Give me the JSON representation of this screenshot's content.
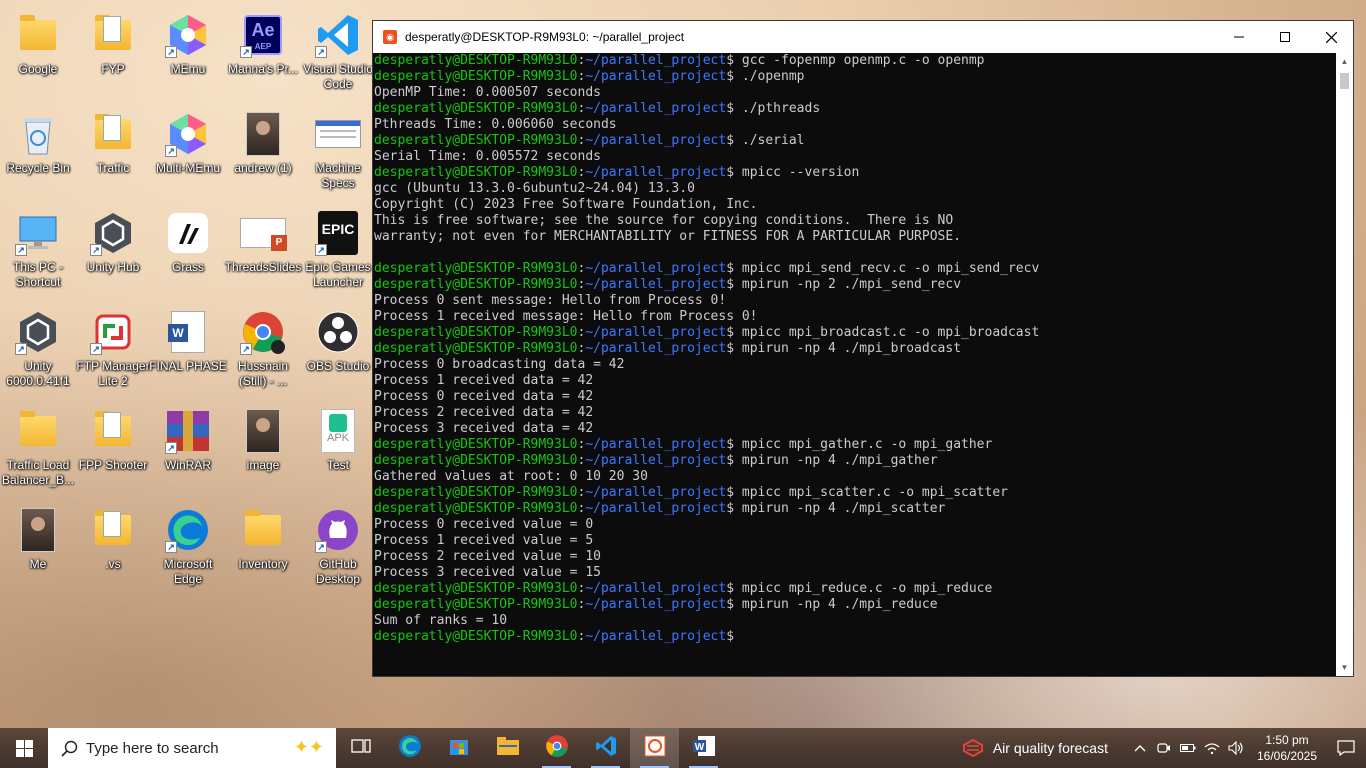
{
  "desktop": {
    "icons": [
      {
        "label": "Google",
        "kind": "folder"
      },
      {
        "label": "FYP",
        "kind": "folder-doc"
      },
      {
        "label": "MEmu",
        "kind": "memu"
      },
      {
        "label": "Manna's Pr...",
        "kind": "after-effects"
      },
      {
        "label": "Visual Studio Code",
        "kind": "vscode"
      },
      {
        "label": "Recycle Bin",
        "kind": "recycle-bin"
      },
      {
        "label": "Traffic",
        "kind": "folder-doc"
      },
      {
        "label": "Multi-MEmu",
        "kind": "memu"
      },
      {
        "label": "andrew (1)",
        "kind": "photo"
      },
      {
        "label": "Machine Specs",
        "kind": "screenshot"
      },
      {
        "label": "This PC - Shortcut",
        "kind": "this-pc"
      },
      {
        "label": "Unity Hub",
        "kind": "unity"
      },
      {
        "label": "Grass",
        "kind": "grass"
      },
      {
        "label": "ThreadsSlides",
        "kind": "powerpoint"
      },
      {
        "label": "Epic Games Launcher",
        "kind": "epic"
      },
      {
        "label": "Unity 6000.0.41f1",
        "kind": "unity"
      },
      {
        "label": "FTP Manager Lite 2",
        "kind": "ftp"
      },
      {
        "label": "FINAL PHASE",
        "kind": "word"
      },
      {
        "label": "Hussnain (Still) - ...",
        "kind": "chrome"
      },
      {
        "label": "OBS Studio",
        "kind": "obs"
      },
      {
        "label": "Traffic Load Balancer_B...",
        "kind": "folder"
      },
      {
        "label": "FPP Shooter",
        "kind": "folder-doc"
      },
      {
        "label": "WinRAR",
        "kind": "winrar"
      },
      {
        "label": "image",
        "kind": "photo"
      },
      {
        "label": "Test",
        "kind": "apk"
      },
      {
        "label": "Me",
        "kind": "photo"
      },
      {
        "label": ".vs",
        "kind": "folder-doc"
      },
      {
        "label": "Microsoft Edge",
        "kind": "edge"
      },
      {
        "label": "Inventory",
        "kind": "folder"
      },
      {
        "label": "GitHub Desktop",
        "kind": "github"
      }
    ],
    "apk_text": "APK",
    "epic_text": "EPIC",
    "ae_text": "Ae",
    "ae_sub": "AEP"
  },
  "terminal": {
    "title": "desperatly@DESKTOP-R9M93L0: ~/parallel_project",
    "prompt_user": "desperatly@DESKTOP-R9M93L0",
    "prompt_path": "~/parallel_project",
    "lines": [
      {
        "type": "cmd",
        "text": "gcc -fopenmp openmp.c -o openmp"
      },
      {
        "type": "cmd",
        "text": "./openmp"
      },
      {
        "type": "out",
        "text": "OpenMP Time: 0.000507 seconds"
      },
      {
        "type": "cmd",
        "text": "./pthreads"
      },
      {
        "type": "out",
        "text": "Pthreads Time: 0.006060 seconds"
      },
      {
        "type": "cmd",
        "text": "./serial"
      },
      {
        "type": "out",
        "text": "Serial Time: 0.005572 seconds"
      },
      {
        "type": "cmd",
        "text": "mpicc --version"
      },
      {
        "type": "out",
        "text": "gcc (Ubuntu 13.3.0-6ubuntu2~24.04) 13.3.0"
      },
      {
        "type": "out",
        "text": "Copyright (C) 2023 Free Software Foundation, Inc."
      },
      {
        "type": "out",
        "text": "This is free software; see the source for copying conditions.  There is NO"
      },
      {
        "type": "out",
        "text": "warranty; not even for MERCHANTABILITY or FITNESS FOR A PARTICULAR PURPOSE."
      },
      {
        "type": "out",
        "text": ""
      },
      {
        "type": "cmd",
        "text": "mpicc mpi_send_recv.c -o mpi_send_recv"
      },
      {
        "type": "cmd",
        "text": "mpirun -np 2 ./mpi_send_recv"
      },
      {
        "type": "out",
        "text": "Process 0 sent message: Hello from Process 0!"
      },
      {
        "type": "out",
        "text": "Process 1 received message: Hello from Process 0!"
      },
      {
        "type": "cmd",
        "text": "mpicc mpi_broadcast.c -o mpi_broadcast"
      },
      {
        "type": "cmd",
        "text": "mpirun -np 4 ./mpi_broadcast"
      },
      {
        "type": "out",
        "text": "Process 0 broadcasting data = 42"
      },
      {
        "type": "out",
        "text": "Process 1 received data = 42"
      },
      {
        "type": "out",
        "text": "Process 0 received data = 42"
      },
      {
        "type": "out",
        "text": "Process 2 received data = 42"
      },
      {
        "type": "out",
        "text": "Process 3 received data = 42"
      },
      {
        "type": "cmd",
        "text": "mpicc mpi_gather.c -o mpi_gather"
      },
      {
        "type": "cmd",
        "text": "mpirun -np 4 ./mpi_gather"
      },
      {
        "type": "out",
        "text": "Gathered values at root: 0 10 20 30"
      },
      {
        "type": "cmd",
        "text": "mpicc mpi_scatter.c -o mpi_scatter"
      },
      {
        "type": "cmd",
        "text": "mpirun -np 4 ./mpi_scatter"
      },
      {
        "type": "out",
        "text": "Process 0 received value = 0"
      },
      {
        "type": "out",
        "text": "Process 1 received value = 5"
      },
      {
        "type": "out",
        "text": "Process 2 received value = 10"
      },
      {
        "type": "out",
        "text": "Process 3 received value = 15"
      },
      {
        "type": "cmd",
        "text": "mpicc mpi_reduce.c -o mpi_reduce"
      },
      {
        "type": "cmd",
        "text": "mpirun -np 4 ./mpi_reduce"
      },
      {
        "type": "out",
        "text": "Sum of ranks = 10"
      },
      {
        "type": "cmd",
        "text": ""
      }
    ],
    "colors": {
      "user": "#16c60c",
      "path": "#3b78ff",
      "text": "#cccccc",
      "bg": "#0c0c0c"
    }
  },
  "taskbar": {
    "search_placeholder": "Type here to search",
    "apps": [
      "task-view",
      "edge",
      "store",
      "file-explorer",
      "chrome",
      "vscode",
      "ubuntu-terminal",
      "word"
    ],
    "weather_text": "Air quality forecast",
    "time": "1:50 pm",
    "date": "16/06/2025"
  }
}
